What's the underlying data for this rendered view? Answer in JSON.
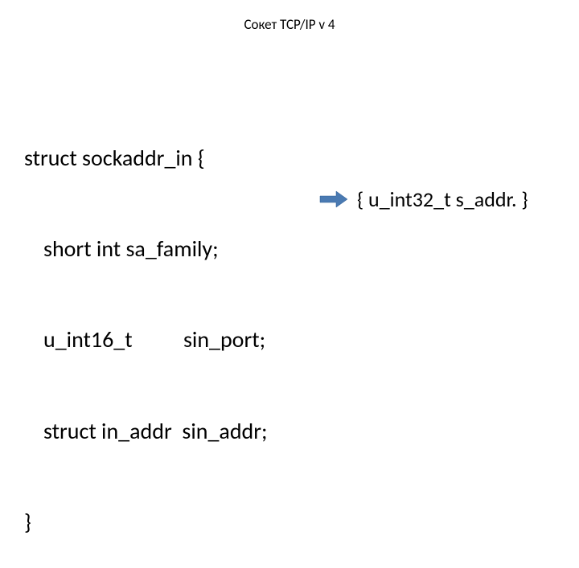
{
  "title": "Сокет TCP/IP v 4",
  "code": {
    "line1": "struct sockaddr_in {",
    "line2": "short int sa_family;",
    "line3_a": "u_int16_t",
    "line3_b": "sin_port;",
    "line4_a": "struct in_addr",
    "line4_b": "sin_addr;",
    "line5": "}"
  },
  "annotation": "{ u_int32_t s_addr. }"
}
